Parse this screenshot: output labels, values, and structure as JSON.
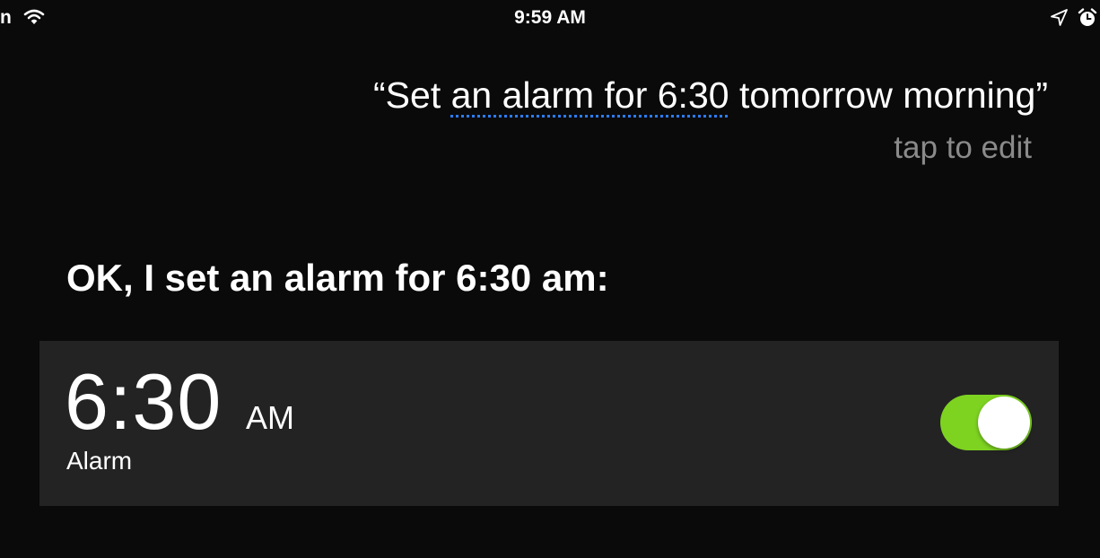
{
  "status_bar": {
    "carrier": "n",
    "time": "9:59 AM",
    "icons": [
      "wifi-icon",
      "location-arrow-icon",
      "alarm-clock-icon"
    ]
  },
  "siri": {
    "query_open": "“Set ",
    "query_highlight": "an alarm for 6:30",
    "query_close": " tomorrow morning”",
    "tap_to_edit": "tap to edit",
    "response": "OK, I set an alarm for 6:30 am:"
  },
  "alarm": {
    "time": "6:30",
    "ampm": "AM",
    "label": "Alarm",
    "enabled": true
  },
  "colors": {
    "background": "#0a0a0a",
    "card": "#232323",
    "toggle_on": "#7ed321",
    "highlight_underline": "#2b7cff",
    "secondary_text": "#8a8a8a"
  }
}
